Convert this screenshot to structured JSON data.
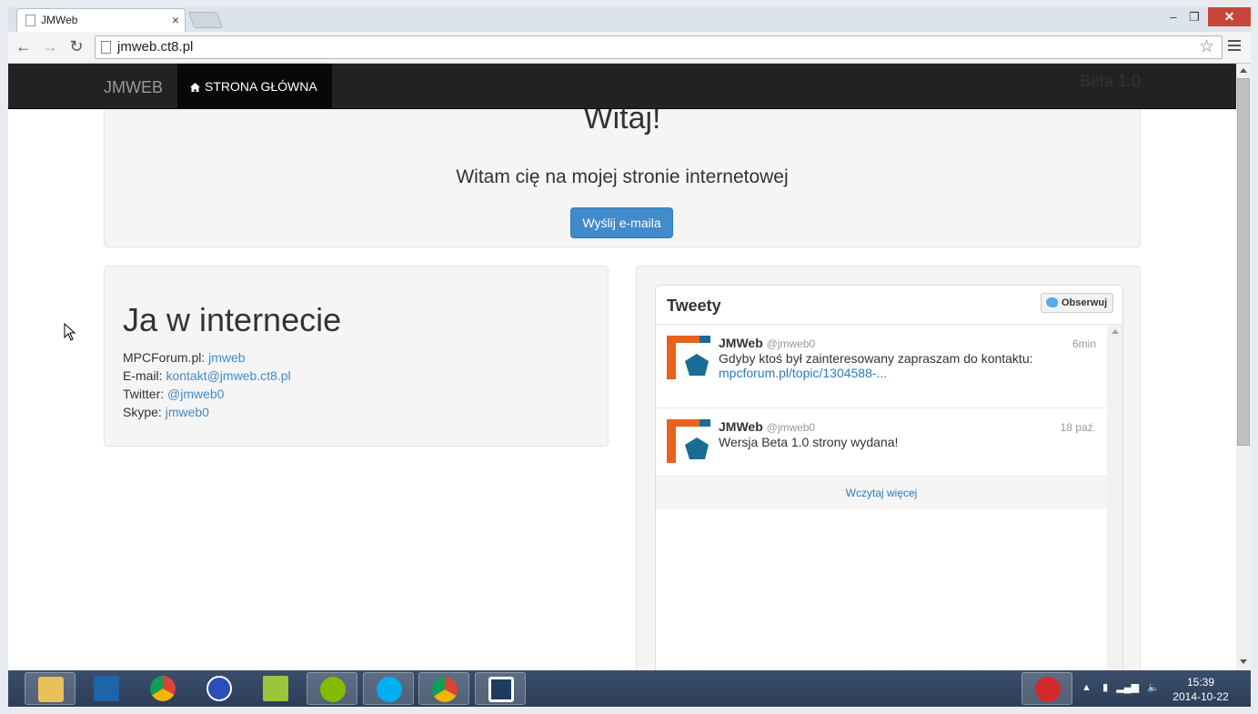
{
  "browser": {
    "tab_title": "JMWeb",
    "url": "jmweb.ct8.pl"
  },
  "navbar": {
    "brand": "JMWEB",
    "active_item": "STRONA GŁÓWNA",
    "version": "Beta 1.0"
  },
  "jumbotron": {
    "heading": "Witaj!",
    "lead": "Witam cię na mojej stronie internetowej",
    "button": "Wyślij e-maila"
  },
  "profile": {
    "heading": "Ja w internecie",
    "items": [
      {
        "label": "MPCForum.pl:",
        "value": "jmweb"
      },
      {
        "label": "E-mail:",
        "value": "kontakt@jmweb.ct8.pl"
      },
      {
        "label": "Twitter:",
        "value": "@jmweb0"
      },
      {
        "label": "Skype:",
        "value": "jmweb0"
      }
    ]
  },
  "twitter": {
    "title": "Tweety",
    "follow": "Obserwuj",
    "tweets": [
      {
        "name": "JMWeb",
        "handle": "@jmweb0",
        "time": "6min",
        "text": "Gdyby ktoś był zainteresowany zapraszam do kontaktu:",
        "link": "mpcforum.pl/topic/1304588-..."
      },
      {
        "name": "JMWeb",
        "handle": "@jmweb0",
        "time": "18 paź.",
        "text": "Wersja Beta 1.0 strony wydana!",
        "link": ""
      }
    ],
    "load_more": "Wczytaj więcej"
  },
  "taskbar": {
    "time": "15:39",
    "date": "2014-10-22"
  },
  "colors": {
    "navbar": "#222222",
    "primary": "#428bca",
    "twitter_link": "#2b7bb9"
  }
}
